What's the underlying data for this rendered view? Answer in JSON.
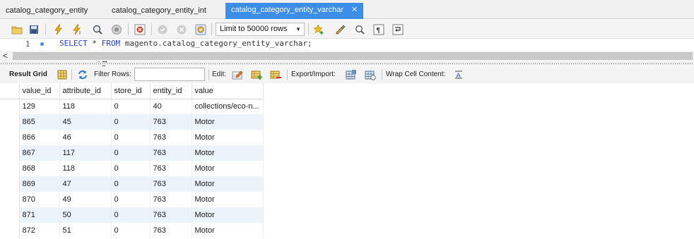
{
  "tabs": [
    {
      "label": "catalog_category_entity"
    },
    {
      "label": "catalog_category_entity_int"
    },
    {
      "label": "catalog_category_entity_varchar",
      "active": true,
      "close": "✕"
    }
  ],
  "toolbar": {
    "limit_select": "Limit to 50000 rows"
  },
  "editor": {
    "line_number": "1",
    "sql_keyword1": "SELECT",
    "sql_star": " * ",
    "sql_keyword2": "FROM",
    "sql_rest": " magento.catalog_category_entity_varchar;"
  },
  "scrollbar": {
    "left_arrow": "<"
  },
  "result_toolbar": {
    "result_grid": "Result Grid",
    "filter_rows": "Filter Rows:",
    "edit": "Edit:",
    "export_import": "Export/Import:",
    "wrap_cell": "Wrap Cell Content:"
  },
  "grid": {
    "columns": [
      "value_id",
      "attribute_id",
      "store_id",
      "entity_id",
      "value"
    ],
    "rows": [
      [
        "129",
        "118",
        "0",
        "40",
        "collections/eco-n..."
      ],
      [
        "865",
        "45",
        "0",
        "763",
        "Motor"
      ],
      [
        "866",
        "46",
        "0",
        "763",
        "Motor"
      ],
      [
        "867",
        "117",
        "0",
        "763",
        "Motor"
      ],
      [
        "868",
        "118",
        "0",
        "763",
        "Motor"
      ],
      [
        "869",
        "47",
        "0",
        "763",
        "Motor"
      ],
      [
        "870",
        "49",
        "0",
        "763",
        "Motor"
      ],
      [
        "871",
        "50",
        "0",
        "763",
        "Motor"
      ],
      [
        "872",
        "51",
        "0",
        "763",
        "Motor"
      ]
    ]
  },
  "colors": {
    "tab_active": "#3d8ee6",
    "sql_keyword": "#2b3fd6",
    "row_alt": "#edf3fb"
  }
}
